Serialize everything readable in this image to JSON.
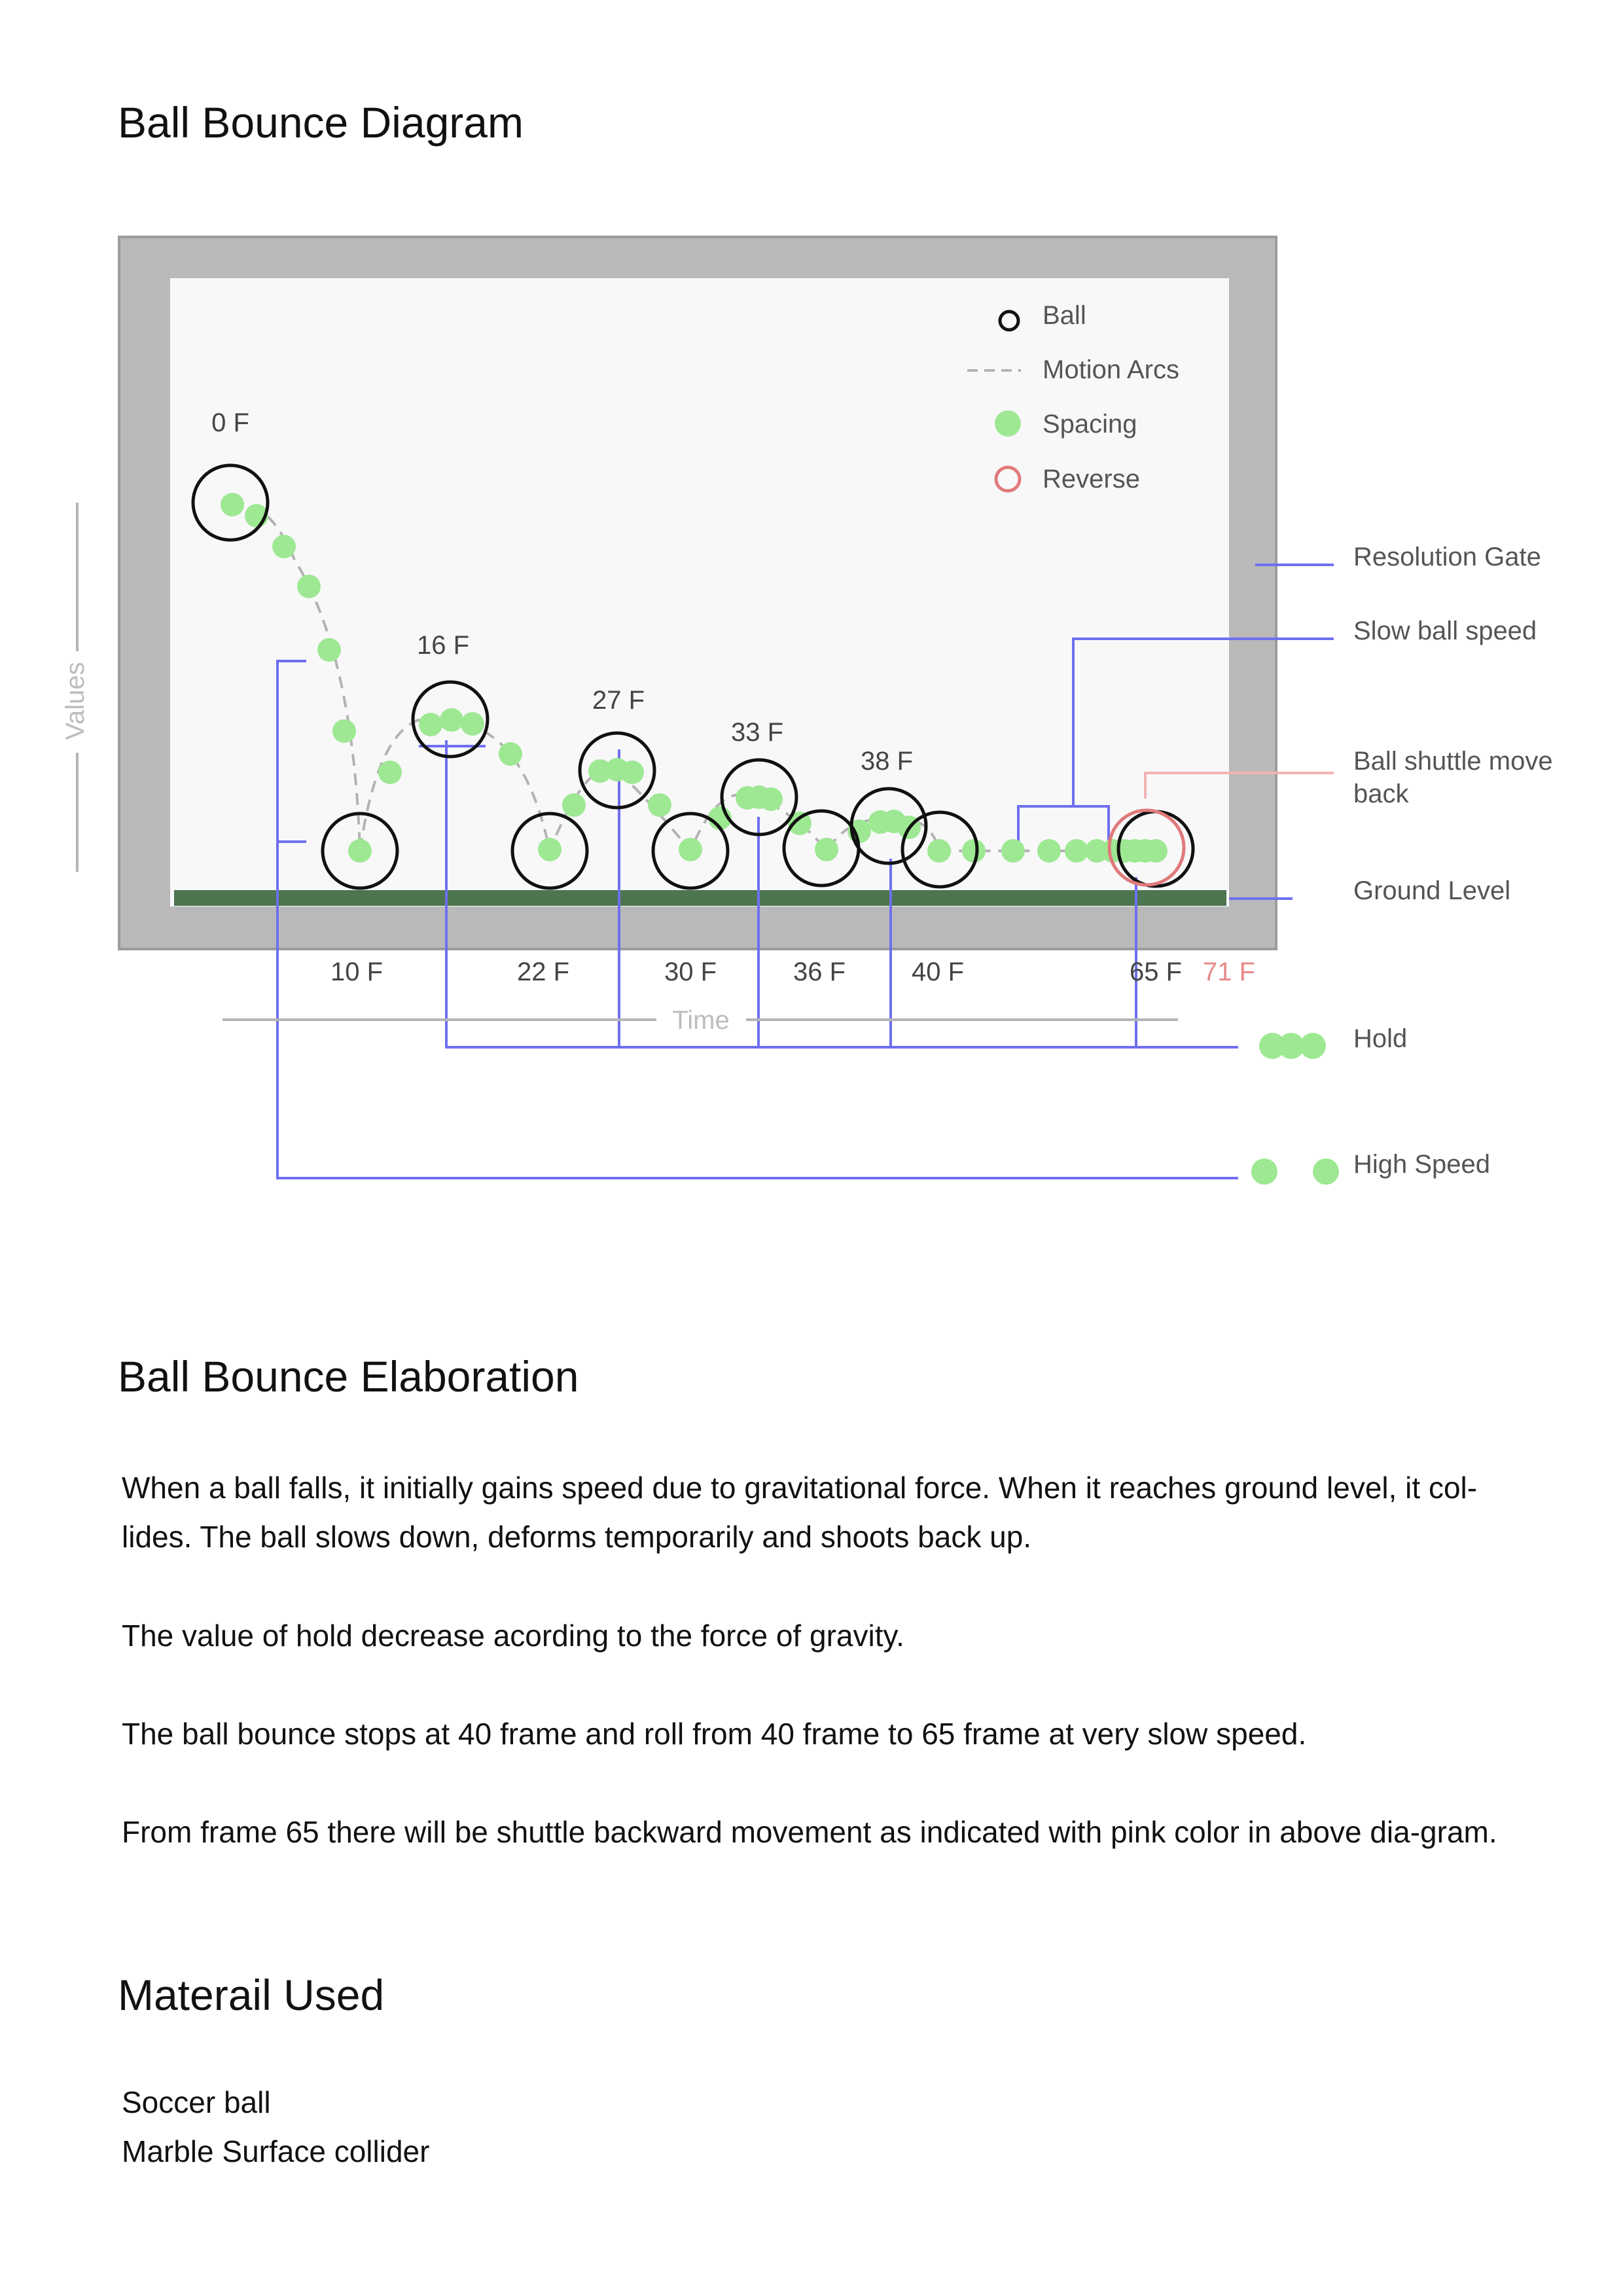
{
  "diagram_title": "Ball Bounce Diagram",
  "legend": {
    "ball": "Ball",
    "motion_arcs": "Motion Arcs",
    "spacing": "Spacing",
    "reverse": "Reverse"
  },
  "frame_labels_top": [
    "0 F",
    "16 F",
    "27 F",
    "33 F",
    "38 F"
  ],
  "frame_labels_bottom": [
    "10 F",
    "22 F",
    "30 F",
    "36 F",
    "40 F",
    "65 F"
  ],
  "frame_label_reverse": "71 F",
  "axis": {
    "values": "Values",
    "time": "Time"
  },
  "callouts": {
    "resolution_gate": "Resolution Gate",
    "slow_ball_speed": "Slow ball speed",
    "shuttle_line1": "Ball shuttle move",
    "shuttle_line2": "back",
    "ground_level": "Ground Level",
    "hold": "Hold",
    "high_speed": "High Speed"
  },
  "colors": {
    "spacing": "#9ee893",
    "ball_outline": "#111111",
    "reverse": "#e07a7a",
    "callout_lines": "#6f6ff0",
    "ground": "#4c7550",
    "frame": "#b9b9b9",
    "canvas": "#f8f8f9"
  },
  "elaboration": {
    "title": "Ball Bounce Elaboration",
    "p1": "When a ball falls, it initially gains speed due to gravitational force. When it reaches ground level, it col-lides. The ball slows down, deforms temporarily and shoots back up.",
    "p2": "The value of hold decrease acording to the force of gravity.",
    "p3": "The ball bounce stops at 40 frame and roll from 40 frame to 65 frame at very slow speed.",
    "p4": "From frame 65 there will be shuttle backward movement as indicated with pink color in above dia-gram."
  },
  "materials": {
    "title": "Materail Used",
    "items": [
      "Soccer ball",
      "Marble Surface collider"
    ]
  }
}
